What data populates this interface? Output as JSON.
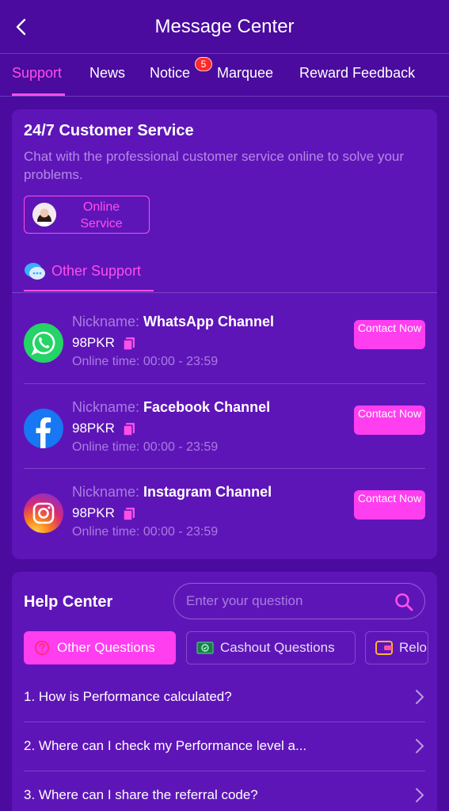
{
  "header": {
    "title": "Message Center"
  },
  "tabs": [
    {
      "label": "Support"
    },
    {
      "label": "News"
    },
    {
      "label": "Notice"
    },
    {
      "label": "Marquee"
    },
    {
      "label": "Reward Feedback"
    }
  ],
  "notice_badge": "5",
  "customer_service": {
    "title": "24/7 Customer Service",
    "description": "Chat with the professional customer service online to solve your problems.",
    "online_button": "Online Service"
  },
  "other_support": {
    "label": "Other Support"
  },
  "channels": [
    {
      "nickname_label": "Nickname:",
      "nickname": "WhatsApp Channel",
      "currency": "98PKR",
      "time_label": "Online time:",
      "time": "00:00 - 23:59",
      "button": "Contact Now",
      "icon": "whatsapp-icon",
      "color": "#25d366"
    },
    {
      "nickname_label": "Nickname:",
      "nickname": "Facebook Channel",
      "currency": "98PKR",
      "time_label": "Online time:",
      "time": "00:00 - 23:59",
      "button": "Contact Now",
      "icon": "facebook-icon",
      "color": "#1877f2"
    },
    {
      "nickname_label": "Nickname:",
      "nickname": "Instagram Channel",
      "currency": "98PKR",
      "time_label": "Online time:",
      "time": "00:00 - 23:59",
      "button": "Contact Now",
      "icon": "instagram-icon",
      "color": "#e1306c"
    }
  ],
  "help_center": {
    "title": "Help Center",
    "search_placeholder": "Enter your question",
    "categories": [
      {
        "label": "Other Questions",
        "icon": "question-icon"
      },
      {
        "label": "Cashout Questions",
        "icon": "cash-icon"
      },
      {
        "label": "Relo",
        "icon": "wallet-icon"
      }
    ],
    "questions": [
      {
        "text": "1. How is Performance calculated?"
      },
      {
        "text": "2. Where can I check my Performance level a..."
      },
      {
        "text": "3. Where can I share the referral code?"
      }
    ]
  },
  "colors": {
    "background": "#4a0b9e",
    "card": "#5e15b8",
    "accent": "#ff3ef0"
  }
}
